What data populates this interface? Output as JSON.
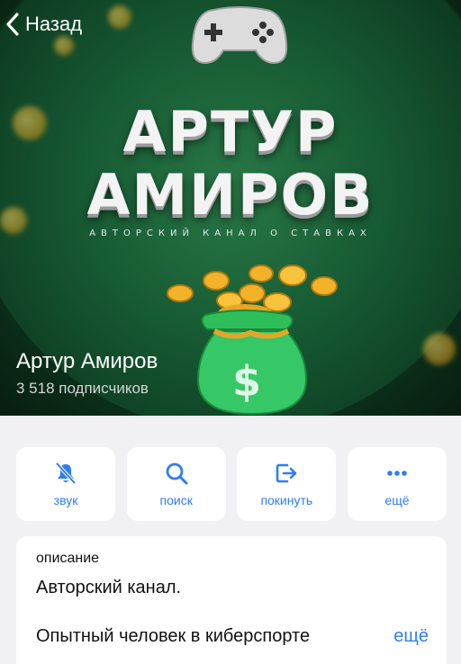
{
  "nav": {
    "back_label": "Назад"
  },
  "cover": {
    "title_line1": "АРТУР",
    "title_line2": "АМИРОВ",
    "subtitle": "АВТОРСКИЙ КАНАЛ О СТАВКАХ"
  },
  "channel": {
    "name": "Артур Амиров",
    "subscribers": "3 518 подписчиков"
  },
  "actions": [
    {
      "label": "звук",
      "icon": "bell-slash-icon"
    },
    {
      "label": "поиск",
      "icon": "search-icon"
    },
    {
      "label": "покинуть",
      "icon": "leave-icon"
    },
    {
      "label": "ещё",
      "icon": "more-dots-icon"
    }
  ],
  "description": {
    "label": "описание",
    "line1": "Авторский канал.",
    "line2": "Опытный человек в киберспорте",
    "more": "ещё"
  },
  "colors": {
    "accent": "#2f7cf6",
    "background": "#f0f0f5",
    "hero_green": "#124a2a"
  }
}
